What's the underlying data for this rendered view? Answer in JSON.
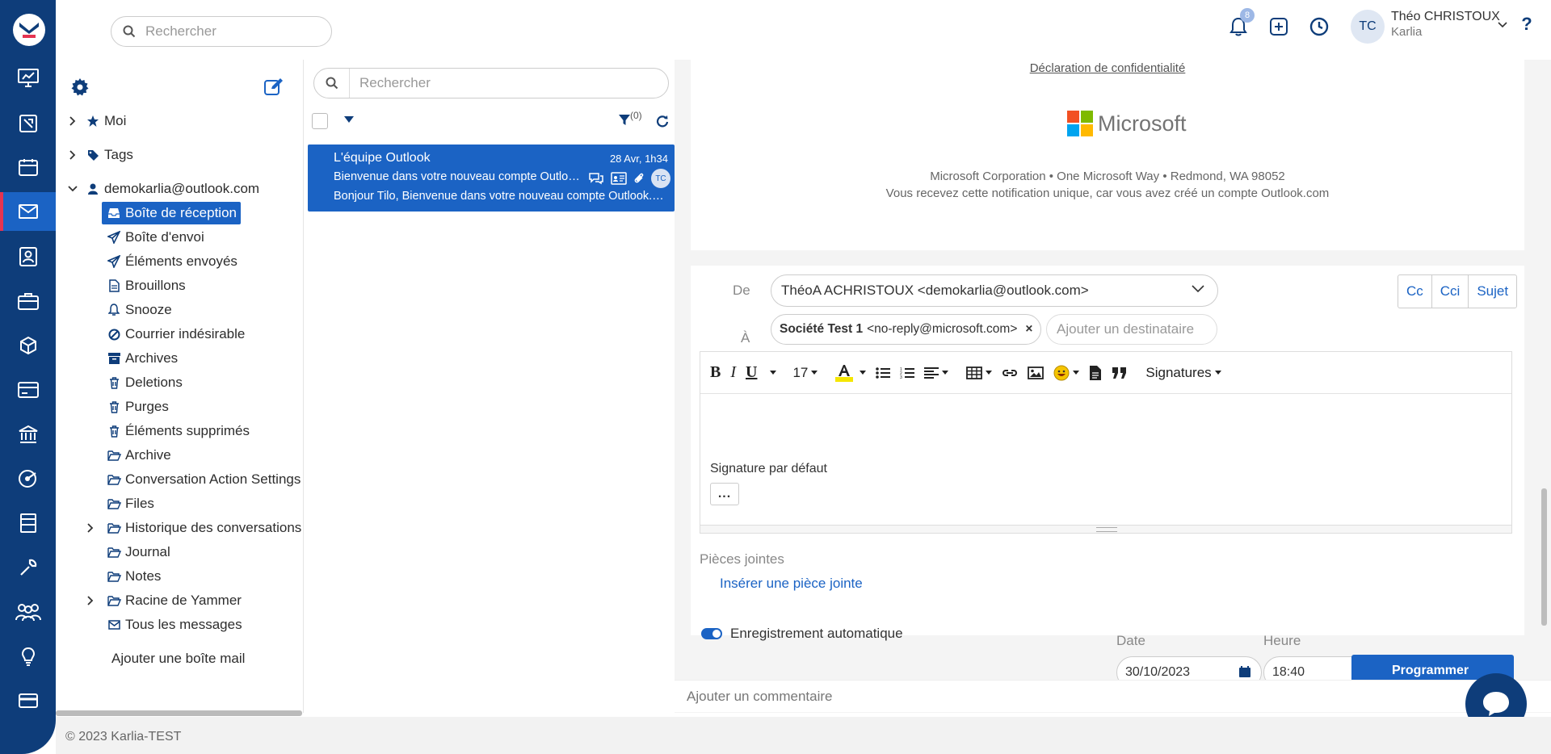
{
  "topbar": {
    "search_placeholder": "Rechercher",
    "notification_count": "8",
    "user_initials": "TC",
    "user_name": "Théo CHRISTOUX",
    "user_org": "Karlia"
  },
  "rail_icons": [
    "dashboard-icon",
    "tasks-icon",
    "calendar-icon",
    "mail-icon",
    "contacts-icon",
    "briefcase-icon",
    "products-icon",
    "billing-icon",
    "bank-icon",
    "support-icon",
    "documents-icon",
    "tools-icon",
    "team-icon",
    "ideas-icon",
    "payment-icon"
  ],
  "rail_active": "mail-icon",
  "folders": {
    "groups": [
      {
        "label": "Moi",
        "icon": "star-icon"
      },
      {
        "label": "Tags",
        "icon": "tag-icon"
      },
      {
        "label": "demokarlia@outlook.com",
        "icon": "user-icon"
      }
    ],
    "items": [
      {
        "label": "Boîte de réception",
        "icon": "inbox-icon",
        "selected": true
      },
      {
        "label": "Boîte d'envoi",
        "icon": "send-icon"
      },
      {
        "label": "Éléments envoyés",
        "icon": "send-icon"
      },
      {
        "label": "Brouillons",
        "icon": "draft-icon"
      },
      {
        "label": "Snooze",
        "icon": "bell-icon"
      },
      {
        "label": "Courrier indésirable",
        "icon": "ban-icon"
      },
      {
        "label": "Archives",
        "icon": "archive-icon"
      },
      {
        "label": "Deletions",
        "icon": "trash-icon"
      },
      {
        "label": "Purges",
        "icon": "trash-icon"
      },
      {
        "label": "Éléments supprimés",
        "icon": "trash-icon"
      },
      {
        "label": "Archive",
        "icon": "folder-icon"
      },
      {
        "label": "Conversation Action Settings",
        "icon": "folder-icon"
      },
      {
        "label": "Files",
        "icon": "folder-icon"
      },
      {
        "label": "Historique des conversations",
        "icon": "folder-icon",
        "expandable": true
      },
      {
        "label": "Journal",
        "icon": "folder-icon"
      },
      {
        "label": "Notes",
        "icon": "folder-icon"
      },
      {
        "label": "Racine de Yammer",
        "icon": "folder-icon",
        "expandable": true
      },
      {
        "label": "Tous les messages",
        "icon": "mail-icon"
      }
    ],
    "add_mailbox": "Ajouter une boîte mail"
  },
  "message_list": {
    "search_placeholder": "Rechercher",
    "filter_count": "(0)",
    "messages": [
      {
        "from": "L'équipe Outlook",
        "date": "28 Avr, 1h34",
        "subject": "Bienvenue dans votre nouveau compte Outlook.com",
        "preview": "Bonjour Tilo, Bienvenue dans votre nouveau compte Outlook.com",
        "initials": "TC"
      }
    ]
  },
  "email": {
    "privacy_link": "Déclaration de confidentialité",
    "logo_text": "Microsoft",
    "address": "Microsoft Corporation • One Microsoft Way • Redmond, WA 98052",
    "notice": "Vous recevez cette notification unique, car vous avez créé un compte Outlook.com"
  },
  "compose": {
    "from_label": "De",
    "from_value": "ThéoA ACHRISTOUX <demokarlia@outlook.com>",
    "to_label": "À",
    "recipient_name": "Société Test 1",
    "recipient_email": "<no-reply@microsoft.com>",
    "add_recipient_placeholder": "Ajouter un destinataire",
    "cc_label": "Cc",
    "cci_label": "Cci",
    "subject_label": "Sujet",
    "font_size": "17",
    "signatures_label": "Signatures",
    "signature_text": "Signature par défaut",
    "more_label": "...",
    "attachments_label": "Pièces jointes",
    "insert_attachment": "Insérer une pièce jointe",
    "autosave_label": "Enregistrement automatique",
    "date_label": "Date",
    "date_value": "30/10/2023",
    "time_label": "Heure",
    "time_value": "18:40",
    "schedule_label": "Programmer",
    "comment_placeholder": "Ajouter un commentaire"
  },
  "footer": {
    "copyright": "© 2023 Karlia-TEST"
  },
  "colors": {
    "rail": "#0e3d7a",
    "accent": "#1b63c4",
    "active_marker": "#e53451"
  }
}
